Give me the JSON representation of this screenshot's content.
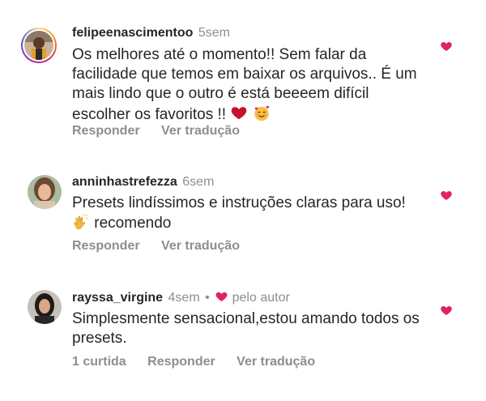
{
  "colors": {
    "like_red": "#e0245e",
    "muted": "#8e8e8e",
    "text": "#262626"
  },
  "comments": [
    {
      "username": "felipeenascimentoo",
      "time": "5sem",
      "text": "Os melhores até o momento!! Sem falar da facilidade que temos em baixar os arquivos.. É um mais lindo que o outro é está beeeem difícil escolher os favoritos !!",
      "emojis": [
        "red-heart",
        "smiling-face-with-hearts"
      ],
      "reply": "Responder",
      "translate": "Ver tradução"
    },
    {
      "username": "anninhastrefezza",
      "time": "6sem",
      "text_line1": "Presets lindíssimos e instruções claras para uso!",
      "text_line2": "recomendo",
      "emojis": [
        "clapping-hands"
      ],
      "reply": "Responder",
      "translate": "Ver tradução"
    },
    {
      "username": "rayssa_virgine",
      "time": "4sem",
      "dot": "•",
      "by_author": "pelo autor",
      "text": "Simplesmente sensacional,estou amando todos os presets.",
      "likes": "1 curtida",
      "reply": "Responder",
      "translate": "Ver tradução"
    }
  ]
}
